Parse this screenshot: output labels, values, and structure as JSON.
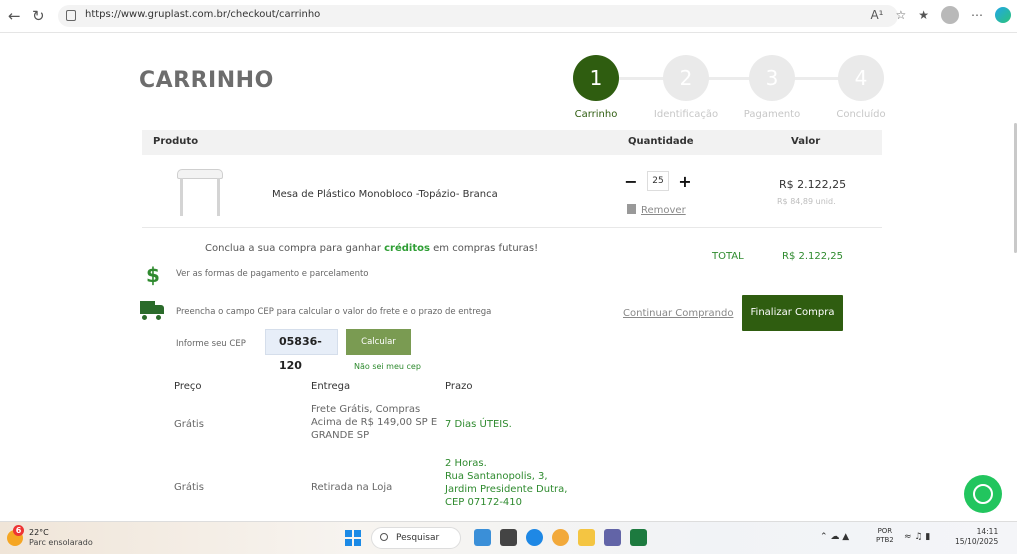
{
  "browser": {
    "url": "https://www.gruplast.com.br/checkout/carrinho",
    "read_aloud_icon": "A¹"
  },
  "page": {
    "title": "CARRINHO",
    "steps": [
      {
        "number": "1",
        "label": "Carrinho"
      },
      {
        "number": "2",
        "label": "Identificação"
      },
      {
        "number": "3",
        "label": "Pagamento"
      },
      {
        "number": "4",
        "label": "Concluído"
      }
    ],
    "table_headers": {
      "product": "Produto",
      "quantity": "Quantidade",
      "value": "Valor"
    },
    "item": {
      "name": "Mesa de Plástico Monobloco -Topázio- Branca",
      "quantity": "25",
      "minus": "−",
      "plus": "+",
      "remove": "Remover",
      "price": "R$ 2.122,25",
      "unit_price": "R$ 84,89 unid."
    },
    "credits_prefix": "Conclua a sua compra para ganhar",
    "credits_bold": "créditos",
    "credits_suffix": "em compras futuras!",
    "dollar_icon": "$",
    "payment_forms": "Ver as formas de pagamento e parcelamento",
    "total_label": "TOTAL",
    "total_value": "R$ 2.122,25",
    "freight_text": "Preencha o campo CEP para calcular o valor do frete e o prazo de entrega",
    "continue_label": "Continuar Comprando",
    "finalize_label": "Finalizar Compra",
    "cep_label": "Informe seu CEP",
    "cep_value": "05836-120",
    "calc_label": "Calcular",
    "not_sure_label": "Não sei meu cep",
    "shipping_headers": {
      "price": "Preço",
      "delivery": "Entrega",
      "deadline": "Prazo"
    },
    "shipping_rows": [
      {
        "price": "Grátis",
        "delivery_line1": "Frete Grátis, Compras",
        "delivery_line2": "Acima de R$ 149,00 SP E",
        "delivery_line3": "GRANDE SP",
        "deadline_line1": "7 Dias ÚTEIS."
      },
      {
        "price": "Grátis",
        "delivery_line1": "Retirada na Loja",
        "deadline_line1": "2 Horas.",
        "deadline_line2": "Rua Santanopolis, 3,",
        "deadline_line3": "Jardim Presidente Dutra,",
        "deadline_line4": "CEP 07172-410"
      }
    ]
  },
  "taskbar": {
    "weather_temp": "22°C",
    "weather_desc": "Parc ensolarado",
    "notification_count": "6",
    "search_placeholder": "Pesquisar",
    "lang_line1": "POR",
    "lang_line2": "PTB2",
    "time": "14:11",
    "date": "15/10/2025"
  },
  "colors": {
    "brand_green": "#2f5d10",
    "accent_green": "#2e8a2e"
  }
}
